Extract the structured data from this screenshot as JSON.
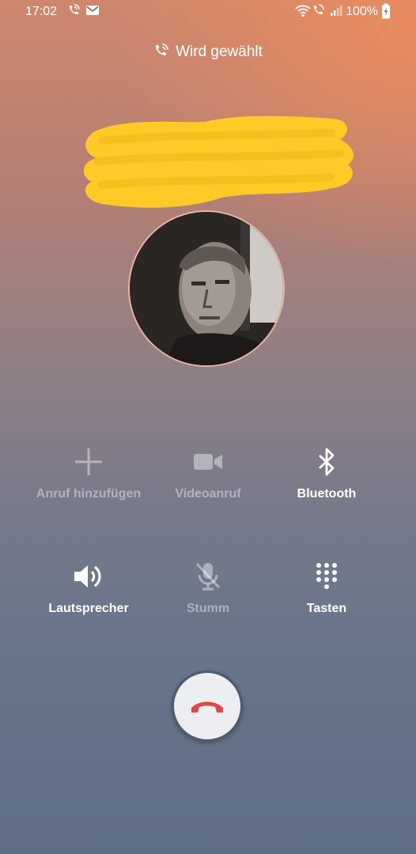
{
  "status_bar": {
    "time": "17:02",
    "battery": "100%"
  },
  "call": {
    "status": "Wird gewählt",
    "contact_name_redacted": true
  },
  "actions": [
    {
      "label": "Anruf hinzufügen",
      "icon": "add-icon",
      "enabled": false
    },
    {
      "label": "Videoanruf",
      "icon": "video-camera-icon",
      "enabled": false
    },
    {
      "label": "Bluetooth",
      "icon": "bluetooth-icon",
      "enabled": true
    },
    {
      "label": "Lautsprecher",
      "icon": "speaker-icon",
      "enabled": true
    },
    {
      "label": "Stumm",
      "icon": "mute-microphone-icon",
      "enabled": false
    },
    {
      "label": "Tasten",
      "icon": "keypad-icon",
      "enabled": true
    }
  ],
  "end_call": {
    "icon": "end-call-icon",
    "color": "#e04848"
  },
  "colors": {
    "redaction": "#ffc928",
    "enabled_text": "#ffffff"
  }
}
